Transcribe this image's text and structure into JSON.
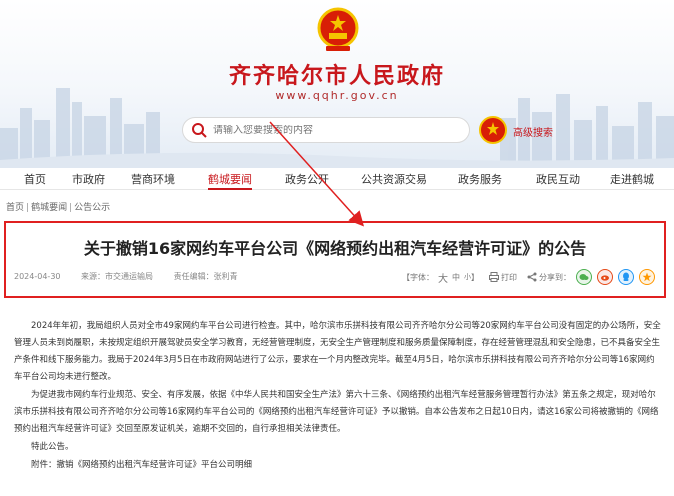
{
  "site": {
    "title": "齐齐哈尔市人民政府",
    "url": "www.qqhr.gov.cn"
  },
  "search": {
    "placeholder": "请输入您要搜索的内容",
    "advanced_label": "高级搜索"
  },
  "nav": {
    "items": [
      {
        "label": "首页"
      },
      {
        "label": "市政府"
      },
      {
        "label": "营商环境"
      },
      {
        "label": "鹤城要闻"
      },
      {
        "label": "政务公开"
      },
      {
        "label": "公共资源交易"
      },
      {
        "label": "政务服务"
      },
      {
        "label": "政民互动"
      },
      {
        "label": "走进鹤城"
      }
    ],
    "active_index": 3
  },
  "breadcrumb": [
    "首页",
    "鹤城要闻",
    "公告公示"
  ],
  "article": {
    "title": "关于撤销16家网约车平台公司《网络预约出租汽车经营许可证》的公告",
    "date": "2024-04-30",
    "source": "来源：市交通运输局",
    "editor": "责任编辑：张利青",
    "font_label": "【字体：",
    "font_large": "大",
    "font_medium": "中",
    "font_small": "小",
    "font_close": "】",
    "print_label": "打印",
    "share_label": "分享到："
  },
  "body": {
    "p1": "2024年年初，我局组织人员对全市49家网约车平台公司进行检查。其中，哈尔滨市乐拼科技有限公司齐齐哈尔分公司等20家网约车平台公司没有固定的办公场所，安全管理人员未到岗履职，未按规定组织开展驾驶员安全学习教育，无经营管理制度，无安全生产管理制度和服务质量保障制度，存在经营管理混乱和安全隐患，已不具备安全生产条件和线下服务能力。我局于2024年3月5日在市政府网站进行了公示，要求在一个月内整改完毕。截至4月5日，哈尔滨市乐拼科技有限公司齐齐哈尔分公司等16家网约车平台公司均未进行整改。",
    "p2": "为促进我市网约车行业规范、安全、有序发展，依据《中华人民共和国安全生产法》第六十三条、《网络预约出租汽车经营服务管理暂行办法》第五条之规定，现对哈尔滨市乐拼科技有限公司齐齐哈尔分公司等16家网约车平台公司的《网络预约出租汽车经营许可证》予以撤销。自本公告发布之日起10日内，请这16家公司将被撤销的《网络预约出租汽车经营许可证》交回至原发证机关，逾期不交回的，自行承担相关法律责任。",
    "p3": "特此公告。",
    "attachment": "附件：撤销《网络预约出租汽车经营许可证》平台公司明细"
  },
  "colors": {
    "brand_red": "#c8171c",
    "highlight_box": "#e02020",
    "share_wechat": "#4caf50",
    "share_weibo": "#e64a19",
    "share_qq": "#2196f3",
    "share_other": "#ff9800"
  }
}
